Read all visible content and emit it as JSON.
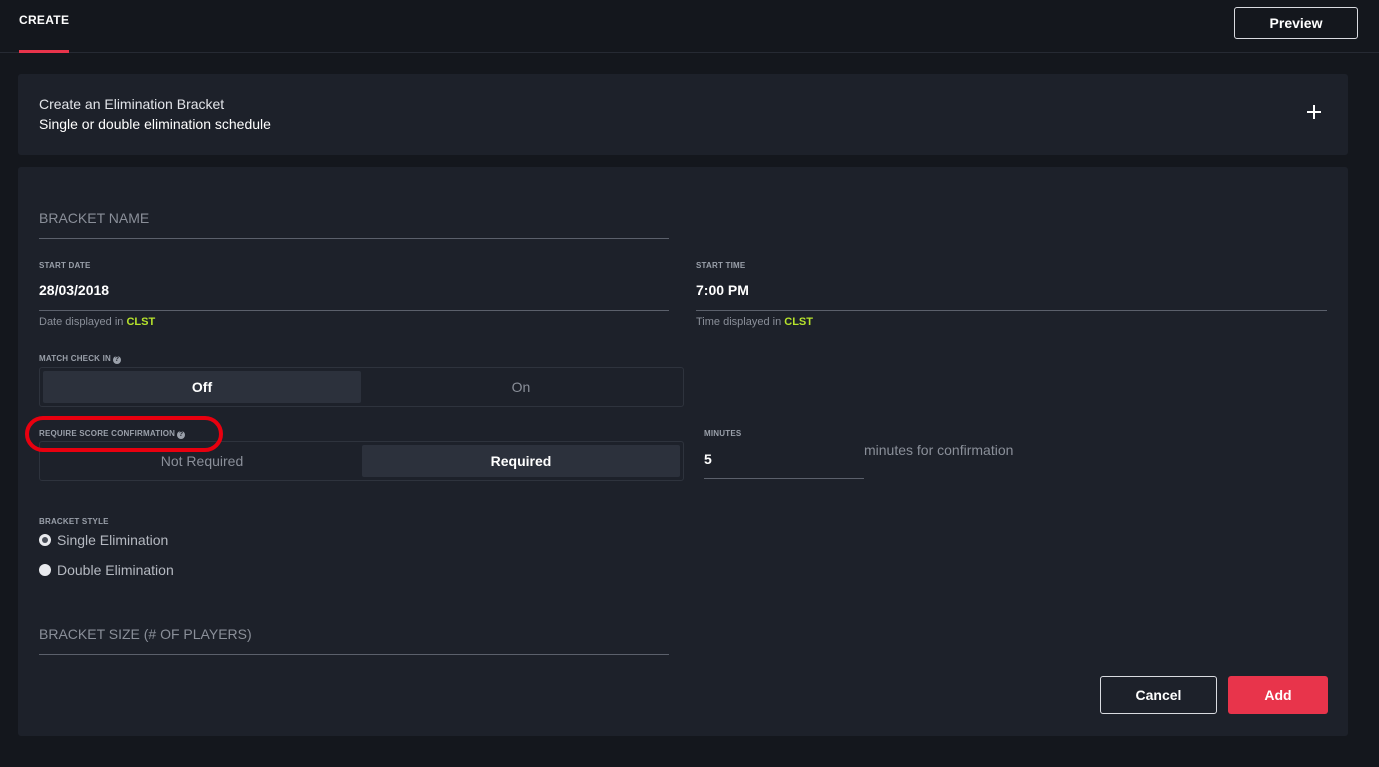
{
  "topbar": {
    "tab_create": "CREATE",
    "preview_label": "Preview"
  },
  "header_card": {
    "title": "Create an Elimination Bracket",
    "subtitle": "Single or double elimination schedule"
  },
  "form": {
    "bracket_name_placeholder": "BRACKET NAME",
    "start_date": {
      "label": "START DATE",
      "value": "28/03/2018",
      "hint_prefix": "Date displayed in ",
      "hint_tz": "CLST"
    },
    "start_time": {
      "label": "START TIME",
      "value": "7:00 PM",
      "hint_prefix": "Time displayed in ",
      "hint_tz": "CLST"
    },
    "match_check_in": {
      "label": "MATCH CHECK IN",
      "options": [
        "Off",
        "On"
      ],
      "selected": "Off"
    },
    "score_confirmation": {
      "label": "REQUIRE SCORE CONFIRMATION",
      "options": [
        "Not Required",
        "Required"
      ],
      "selected": "Required"
    },
    "minutes": {
      "label": "MINUTES",
      "value": "5",
      "suffix": "minutes for confirmation"
    },
    "bracket_style": {
      "label": "BRACKET STYLE",
      "options": [
        "Single Elimination",
        "Double Elimination"
      ],
      "selected": "Single Elimination"
    },
    "bracket_size_placeholder": "BRACKET SIZE (# OF PLAYERS)",
    "cancel_label": "Cancel",
    "add_label": "Add"
  },
  "colors": {
    "accent_red": "#e8344b",
    "timezone_green": "#b6e32c",
    "annotation_red": "#e8000f"
  }
}
